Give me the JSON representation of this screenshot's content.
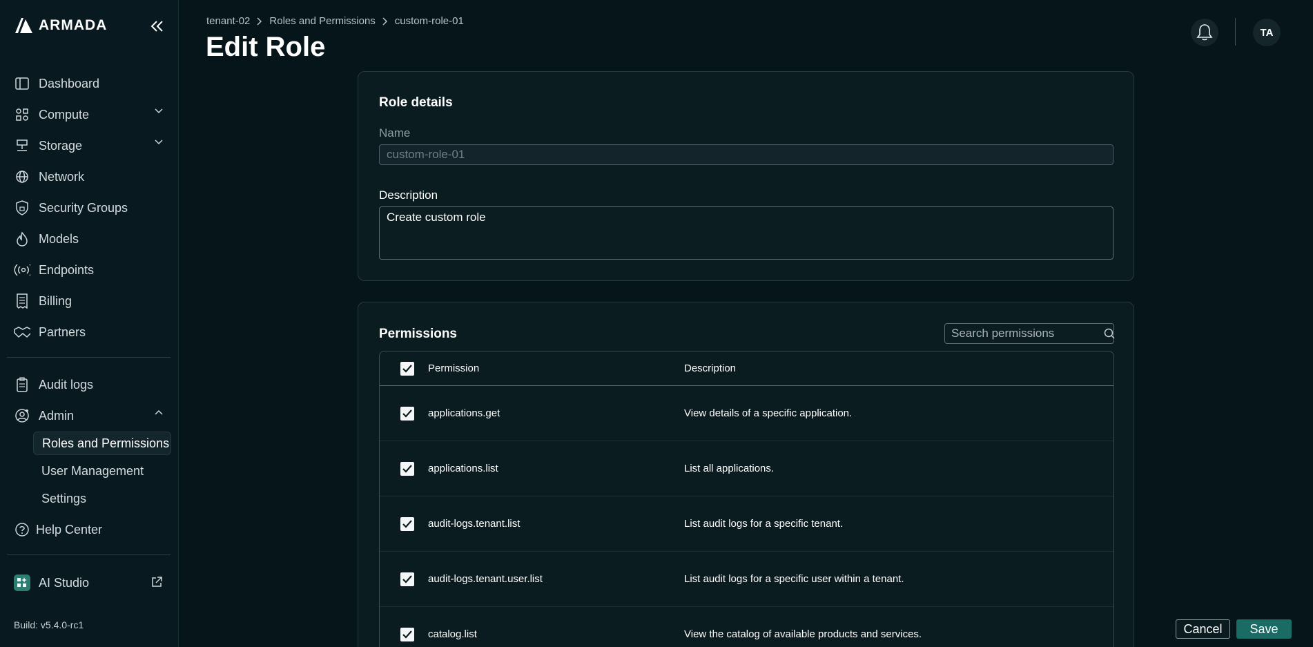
{
  "app": {
    "name": "ARMADA"
  },
  "sidebar": {
    "items": [
      {
        "label": "Dashboard"
      },
      {
        "label": "Compute"
      },
      {
        "label": "Storage"
      },
      {
        "label": "Network"
      },
      {
        "label": "Security Groups"
      },
      {
        "label": "Models"
      },
      {
        "label": "Endpoints"
      },
      {
        "label": "Billing"
      },
      {
        "label": "Partners"
      },
      {
        "label": "Audit logs"
      },
      {
        "label": "Admin"
      },
      {
        "label": "Help Center"
      },
      {
        "label": "AI Studio"
      }
    ],
    "admin_sub": [
      {
        "label": "Roles and Permissions",
        "active": true
      },
      {
        "label": "User Management"
      },
      {
        "label": "Settings"
      }
    ],
    "build": "Build: v5.4.0-rc1"
  },
  "header": {
    "breadcrumb": [
      "tenant-02",
      "Roles and Permissions",
      "custom-role-01"
    ],
    "title": "Edit Role",
    "avatar_initials": "TA"
  },
  "role_details": {
    "title": "Role details",
    "name_label": "Name",
    "name_value": "custom-role-01",
    "description_label": "Description",
    "description_value": "Create custom role"
  },
  "permissions": {
    "title": "Permissions",
    "search_placeholder": "Search permissions",
    "columns": {
      "permission": "Permission",
      "description": "Description"
    },
    "rows": [
      {
        "name": "applications.get",
        "description": "View details of a specific application.",
        "checked": true
      },
      {
        "name": "applications.list",
        "description": "List all applications.",
        "checked": true
      },
      {
        "name": "audit-logs.tenant.list",
        "description": "List audit logs for a specific tenant.",
        "checked": true
      },
      {
        "name": "audit-logs.tenant.user.list",
        "description": "List audit logs for a specific user within a tenant.",
        "checked": true
      },
      {
        "name": "catalog.list",
        "description": "View the catalog of available products and services.",
        "checked": true
      }
    ]
  },
  "actions": {
    "cancel": "Cancel",
    "save": "Save"
  },
  "colors": {
    "background": "#061519",
    "accent": "#1b6b65",
    "card": "#0b1c21"
  }
}
